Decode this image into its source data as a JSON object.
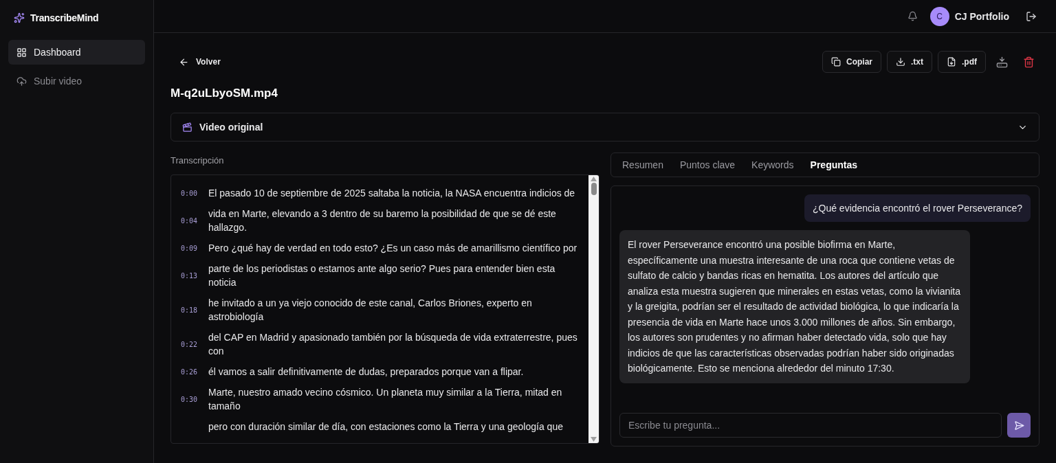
{
  "sidebar": {
    "brand": "TranscribeMind",
    "items": [
      {
        "label": "Dashboard",
        "selected": true
      },
      {
        "label": "Subir video",
        "selected": false
      }
    ]
  },
  "header": {
    "avatar_initial": "C",
    "user_name": "CJ Portfolio"
  },
  "toolbar": {
    "back": "Volver",
    "actions": [
      {
        "kind": "copy",
        "label": "Copiar"
      },
      {
        "kind": "txt",
        "label": ".txt"
      },
      {
        "kind": "pdf",
        "label": ".pdf"
      },
      {
        "kind": "download"
      },
      {
        "kind": "delete"
      }
    ]
  },
  "file_name": "M-q2uLbyoSM.mp4",
  "video_section": {
    "title": "Video original",
    "expanded": false
  },
  "transcript": {
    "title": "Transcripción",
    "lines": [
      {
        "time": "0:00",
        "text": "El pasado 10 de septiembre de 2025 saltaba la noticia, la NASA encuentra indicios de"
      },
      {
        "time": "0:04",
        "text": "vida en Marte, elevando a 3 dentro de su baremo la posibilidad de que se dé este hallazgo."
      },
      {
        "time": "0:09",
        "text": "Pero ¿qué hay de verdad en todo esto? ¿Es un caso más de amarillismo científico por"
      },
      {
        "time": "0:13",
        "text": "parte de los periodistas o estamos ante algo serio? Pues para entender bien esta noticia"
      },
      {
        "time": "0:18",
        "text": "he invitado a un ya viejo conocido de este canal, Carlos Briones, experto en astrobiología"
      },
      {
        "time": "0:22",
        "text": "del CAP en Madrid y apasionado también por la búsqueda de vida extraterrestre, pues con"
      },
      {
        "time": "0:26",
        "text": "él vamos a salir definitivamente de dudas, preparados porque van a flipar."
      },
      {
        "time": "0:30",
        "text": "Marte, nuestro amado vecino cósmico. Un planeta muy similar a la Tierra, mitad en tamaño"
      },
      {
        "text": "pero con duración similar de día, con estaciones como la Tierra y una geología que"
      }
    ]
  },
  "tabs": [
    {
      "label": "Resumen",
      "selected": false
    },
    {
      "label": "Puntos clave",
      "selected": false
    },
    {
      "label": "Keywords",
      "selected": false
    },
    {
      "label": "Preguntas",
      "selected": true
    }
  ],
  "chat": {
    "messages": [
      {
        "kind": "user",
        "text": "¿Qué evidencia encontró el rover Perseverance?"
      },
      {
        "kind": "assistant",
        "text": "El rover Perseverance encontró una posible biofirma en Marte, específicamente una muestra interesante de una roca que contiene vetas de sulfato de calcio y bandas ricas en hematita. Los autores del artículo que analiza esta muestra sugieren que minerales en estas vetas, como la vivianita y la greigita, podrían ser el resultado de actividad biológica, lo que indicaría la presencia de vida en Marte hace unos 3.000 millones de años. Sin embargo, los autores son prudentes y no afirman haber detectado vida, solo que hay indicios de que las características observadas podrían haber sido originadas biológicamente. Esto se menciona alrededor del minuto 17:30."
      }
    ],
    "input": {
      "placeholder": "Escribe tu pregunta..."
    }
  }
}
